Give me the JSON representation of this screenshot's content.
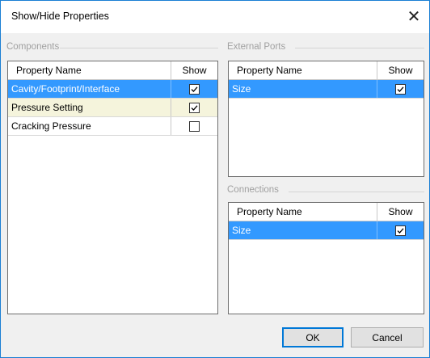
{
  "dialog": {
    "title": "Show/Hide Properties",
    "close_glyph": "✕"
  },
  "components": {
    "label": "Components",
    "headers": {
      "name": "Property Name",
      "show": "Show"
    },
    "rows": [
      {
        "name": "Cavity/Footprint/Interface",
        "checked": true,
        "state": "selected"
      },
      {
        "name": "Pressure Setting",
        "checked": true,
        "state": "hover"
      },
      {
        "name": "Cracking Pressure",
        "checked": false,
        "state": "normal"
      }
    ]
  },
  "external_ports": {
    "label": "External Ports",
    "headers": {
      "name": "Property Name",
      "show": "Show"
    },
    "rows": [
      {
        "name": "Size",
        "checked": true,
        "state": "selected"
      }
    ]
  },
  "connections": {
    "label": "Connections",
    "headers": {
      "name": "Property Name",
      "show": "Show"
    },
    "rows": [
      {
        "name": "Size",
        "checked": true,
        "state": "selected"
      }
    ]
  },
  "buttons": {
    "ok": "OK",
    "cancel": "Cancel"
  },
  "colors": {
    "selection": "#3399ff",
    "hover_row": "#f5f4dc",
    "accent_border": "#0078d7"
  }
}
